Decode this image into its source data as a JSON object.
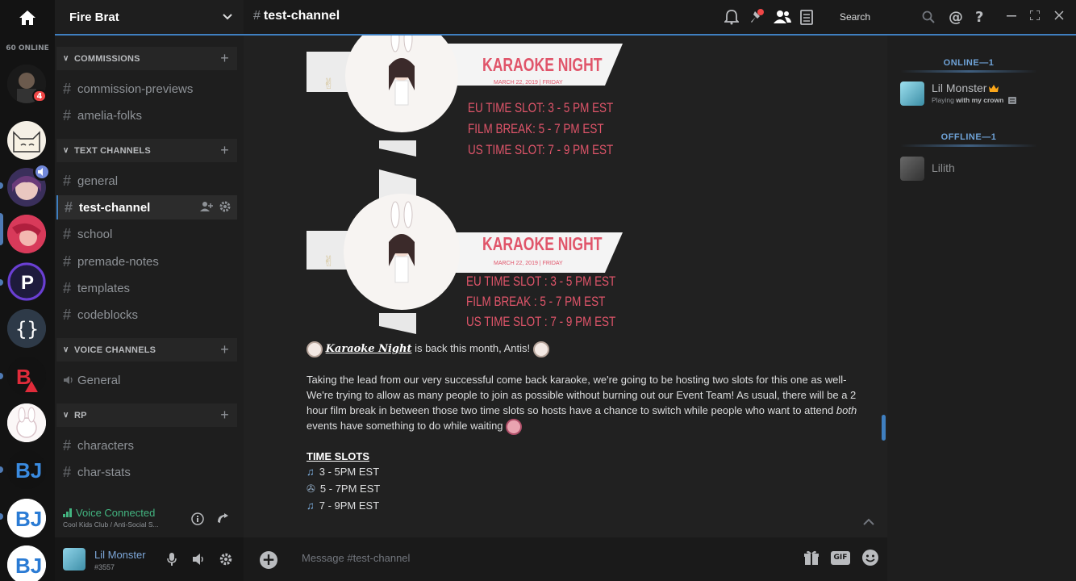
{
  "rail": {
    "online_count": "60 ONLINE",
    "mention_count": "4"
  },
  "guild": {
    "name": "Fire Brat"
  },
  "sidebar": {
    "categories": [
      {
        "label": "COMMISSIONS",
        "channels": [
          "commission-previews",
          "amelia-folks"
        ]
      },
      {
        "label": "TEXT CHANNELS",
        "channels": [
          "general",
          "test-channel",
          "school",
          "premade-notes",
          "templates",
          "codeblocks"
        ]
      },
      {
        "label": "VOICE CHANNELS",
        "channels": [
          "General"
        ]
      },
      {
        "label": "RP",
        "channels": [
          "characters",
          "char-stats"
        ]
      }
    ],
    "active_channel": "test-channel"
  },
  "voice": {
    "status": "Voice Connected",
    "location": "Cool Kids Club / Anti-Social S..."
  },
  "user": {
    "name": "Lil Monster",
    "tag": "#3557"
  },
  "topbar": {
    "channel": "test-channel",
    "search_placeholder": "Search"
  },
  "banners": [
    {
      "title": "KARAOKE NIGHT",
      "date": "MARCH 22, 2019 | FRIDAY",
      "lines": [
        "EU TIME SLOT: 3 - 5 PM EST",
        "FILM BREAK: 5 - 7 PM EST",
        "US TIME SLOT: 7 - 9 PM EST"
      ]
    },
    {
      "title": "KARAOKE NIGHT",
      "date": "MARCH 22, 2019 | FRIDAY",
      "lines": [
        "EU TIME SLOT : 3 - 5 PM EST",
        "FILM BREAK : 5 - 7 PM EST",
        "US TIME SLOT : 7 - 9 PM EST"
      ]
    }
  ],
  "message": {
    "headline_styled": "Karaoke Night",
    "headline_rest": " is back this month, Antis!",
    "body_1": "Taking the lead from our very successful come back karaoke, we're going to be hosting two slots for this one as well- We're trying to allow as many people to join as possible without burning out our Event Team! As usual, there will be a 2 hour film break in between those two time slots so hosts have a chance to switch while people who want to attend ",
    "body_em": "both",
    "body_2": " events have something to do while waiting",
    "time_slots_heading": "TIME SLOTS",
    "slots": [
      "3 - 5PM EST",
      "5 - 7PM EST",
      "7 - 9PM EST"
    ]
  },
  "composer": {
    "placeholder": "Message #test-channel",
    "gif_label": "GIF"
  },
  "members": {
    "online_heading": "ONLINE—1",
    "offline_heading": "OFFLINE—1",
    "online": [
      {
        "name": "Lil Monster",
        "status_prefix": "Playing ",
        "status_game": "with my crown"
      }
    ],
    "offline": [
      {
        "name": "Lilith"
      }
    ]
  },
  "colors": {
    "accent": "#3f7fc0",
    "voice_green": "#43b581",
    "banner_red": "#e0556a"
  }
}
